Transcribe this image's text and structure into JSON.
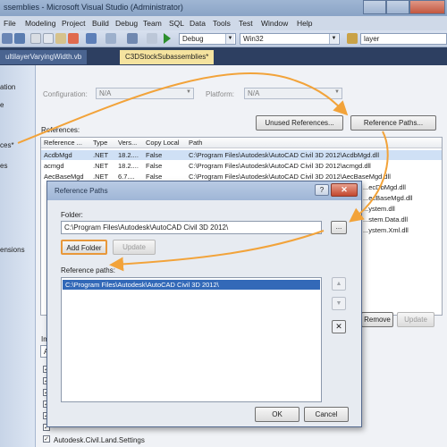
{
  "window": {
    "title": "ssemblies - Microsoft Visual Studio (Administrator)"
  },
  "menu": [
    "File",
    "Modeling",
    "Project",
    "Build",
    "Debug",
    "Team",
    "SQL",
    "Data",
    "Tools",
    "Test",
    "Window",
    "Help"
  ],
  "toolbar": {
    "config": "Debug",
    "platform": "Win32",
    "search": "layer"
  },
  "tabs": {
    "inactive": "ultilayerVaryingWidth.vb",
    "active": "C3DStockSubassemblies*"
  },
  "sidebar": [
    "ation",
    "e",
    "ces*",
    "es",
    "ensions"
  ],
  "settings": {
    "configuration_label": "Configuration:",
    "configuration_value": "N/A",
    "platform_label": "Platform:",
    "platform_value": "N/A",
    "references_label": "References:",
    "unused_refs_btn": "Unused References...",
    "ref_paths_btn": "Reference Paths...",
    "remove_btn": "Remove",
    "update_btn": "Update",
    "imports_label": "Im"
  },
  "references": {
    "columns": [
      "Reference ...",
      "Type",
      "Vers...",
      "Copy Local",
      "Path"
    ],
    "rows": [
      [
        "AcdbMgd",
        ".NET",
        "18.2....",
        "False",
        "C:\\Program Files\\Autodesk\\AutoCAD Civil 3D 2012\\AcdbMgd.dll"
      ],
      [
        "acmgd",
        ".NET",
        "18.2....",
        "False",
        "C:\\Program Files\\Autodesk\\AutoCAD Civil 3D 2012\\acmgd.dll"
      ],
      [
        "AecBaseMgd",
        ".NET",
        "6.7....",
        "False",
        "C:\\Program Files\\Autodesk\\AutoCAD Civil 3D 2012\\AecBaseMgd.dll"
      ],
      [
        "",
        "",
        "",
        "",
        "...ecDbMgd.dll"
      ],
      [
        "",
        "",
        "",
        "",
        "...ecBaseMgd.dll"
      ],
      [
        "",
        "",
        "",
        "",
        "...ystem.dll"
      ],
      [
        "",
        "",
        "",
        "",
        "...stem.Data.dll"
      ],
      [
        "",
        "",
        "",
        "",
        "...ystem.Xml.dll"
      ]
    ]
  },
  "dialog": {
    "title": "Reference Paths",
    "help": "?",
    "close": "✕",
    "folder_label": "Folder:",
    "folder_value": "C:\\Program Files\\Autodesk\\AutoCAD Civil 3D 2012\\",
    "browse": "...",
    "add_folder": "Add Folder",
    "update": "Update",
    "paths_label": "Reference paths:",
    "paths": [
      "C:\\Program Files\\Autodesk\\AutoCAD Civil 3D 2012\\"
    ],
    "move_up": "▲",
    "move_down": "▼",
    "delete": "✕",
    "ok": "OK",
    "cancel": "Cancel"
  },
  "imports": {
    "namespace_input": "A",
    "last_item": "Autodesk.Civil.Land.Settings"
  },
  "colors": {
    "annotation": "#f2a33a",
    "selection": "#3369b8",
    "tab_active": "#f5e39f"
  }
}
